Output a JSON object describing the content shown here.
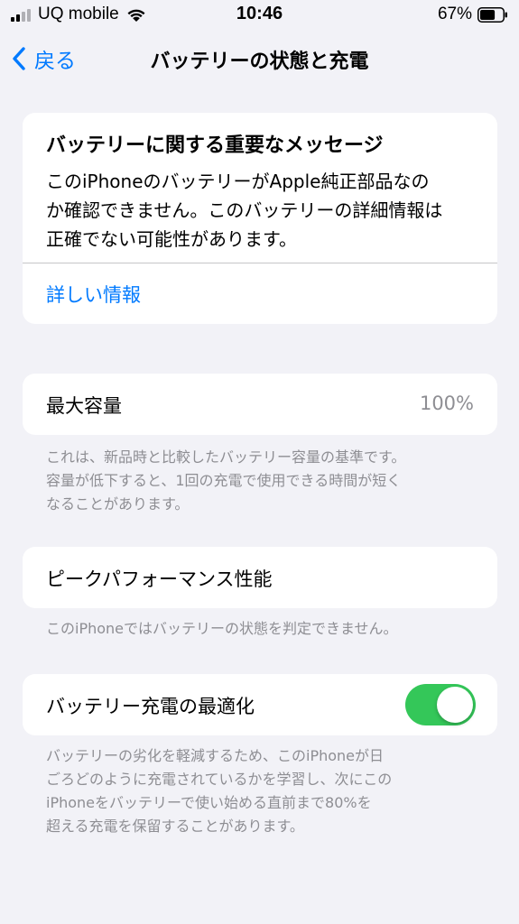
{
  "status_bar": {
    "carrier": "UQ mobile",
    "time": "10:46",
    "battery_percent": "67%",
    "battery_level": 0.67
  },
  "nav": {
    "back_label": "戻る",
    "title": "バッテリーの状態と充電"
  },
  "message_card": {
    "title": "バッテリーに関する重要なメッセージ",
    "body_lines": [
      "このiPhoneのバッテリーがApple純正部品なの",
      "か確認できません。このバッテリーの詳細情報は",
      "正確でない可能性があります。"
    ],
    "link_label": "詳しい情報"
  },
  "max_capacity": {
    "label": "最大容量",
    "value": "100%",
    "footnote_lines": [
      "これは、新品時と比較したバッテリー容量の基準です。",
      "容量が低下すると、1回の充電で使用できる時間が短く",
      "なることがあります。"
    ]
  },
  "peak_performance": {
    "label": "ピークパフォーマンス性能",
    "footnote": "このiPhoneではバッテリーの状態を判定できません。"
  },
  "optimized_charging": {
    "label": "バッテリー充電の最適化",
    "enabled": true,
    "footnote_lines": [
      "バッテリーの劣化を軽減するため、このiPhoneが日",
      "ごろどのように充電されているかを学習し、次にこの",
      "iPhoneをバッテリーで使い始める直前まで80%を",
      "超える充電を保留することがあります。"
    ]
  },
  "colors": {
    "accent": "#007aff",
    "toggle_on": "#34c759",
    "background": "#f2f2f7",
    "secondary_text": "#8e8e93"
  },
  "icons": {
    "signal": "cellular-signal-icon",
    "wifi": "wifi-icon",
    "battery": "battery-icon",
    "back": "chevron-left-icon"
  }
}
